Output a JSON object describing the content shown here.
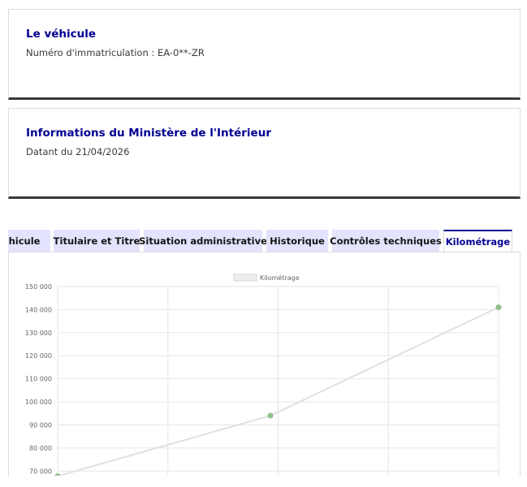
{
  "vehicle_card": {
    "title": "Le véhicule",
    "registration": "Numéro d'immatriculation : EA-0**-ZR"
  },
  "interior_card": {
    "title": "Informations du Ministère de l'Intérieur",
    "date": "Datant du 21/04/2026"
  },
  "tabs": [
    {
      "label": "Véhicule",
      "active": false
    },
    {
      "label": "Titulaire et Titre",
      "active": false
    },
    {
      "label": "Situation administrative",
      "active": false
    },
    {
      "label": "Historique",
      "active": false
    },
    {
      "label": "Contrôles techniques",
      "active": false
    },
    {
      "label": "Kilométrage",
      "active": true
    }
  ],
  "colors": {
    "accent": "#000091",
    "tab_bg": "#e3e3fd",
    "line": "#e0e0e0",
    "point": "#8fc08a"
  },
  "chart_data": {
    "type": "line",
    "series": [
      {
        "name": "Kilométrage",
        "values": [
          67800,
          94000,
          141000
        ]
      }
    ],
    "x": [
      "",
      "",
      ""
    ],
    "y_ticks": [
      "70 000",
      "80 000",
      "90 000",
      "100 000",
      "110 000",
      "120 000",
      "130 000",
      "140 000",
      "150 000"
    ],
    "ylim": [
      68000,
      150000
    ],
    "grid": true,
    "legend": "top-center"
  }
}
